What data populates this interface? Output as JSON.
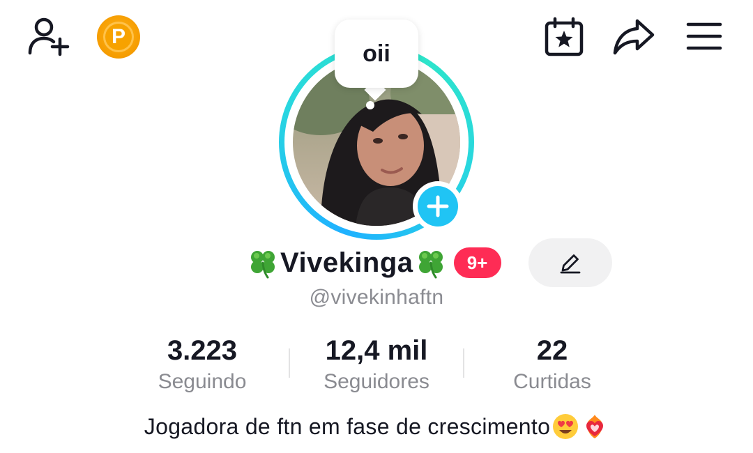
{
  "bubble": {
    "text": "oii"
  },
  "profile": {
    "display_name": "Vivekinga",
    "notification_badge": "9+",
    "username": "@vivekinhaftn",
    "bio": "Jogadora de ftn em fase de crescimento"
  },
  "stats": [
    {
      "value": "3.223",
      "label": "Seguindo"
    },
    {
      "value": "12,4 mil",
      "label": "Seguidores"
    },
    {
      "value": "22",
      "label": "Curtidas"
    }
  ],
  "icons": {
    "add_friend": "add-friend-icon",
    "coin": "coin-icon",
    "calendar": "calendar-star-icon",
    "share": "share-icon",
    "menu": "menu-icon",
    "edit": "pencil-icon",
    "add_story": "plus-icon",
    "clover": "four-leaf-clover-icon",
    "bio_emojis": [
      "heart-eyes-emoji",
      "heart-on-fire-emoji"
    ]
  },
  "coin_letter": "P",
  "colors": {
    "accent_cyan": "#20c4f4",
    "badge_red": "#fe2c55",
    "coin_orange": "#f7a200",
    "muted_text": "#8a8b91"
  }
}
